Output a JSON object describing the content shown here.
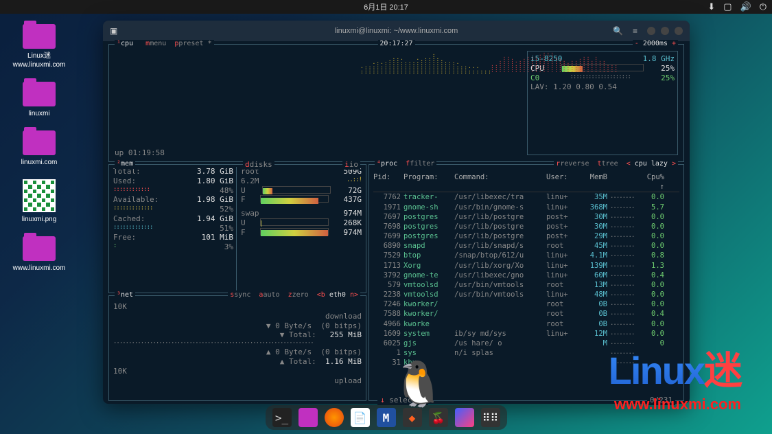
{
  "topbar": {
    "datetime": "6月1日 20:17"
  },
  "desktop": [
    {
      "type": "folder",
      "label": "Linux迷 www.linuxmi.com"
    },
    {
      "type": "folder",
      "label": "linuxmi"
    },
    {
      "type": "folder",
      "label": "linuxmi.com"
    },
    {
      "type": "qr",
      "label": "linuxmi.png"
    },
    {
      "type": "folder",
      "label": "www.linuxmi.com"
    }
  ],
  "terminal": {
    "title": "linuxmi@linuxmi: ~/www.linuxmi.com"
  },
  "btop": {
    "cpu_header": {
      "menu": "menu",
      "preset": "preset *",
      "clock": "20:17:27",
      "rate": "2000ms",
      "minus": "-",
      "plus": "+"
    },
    "uptime": "up 01:19:58",
    "cpu_info": {
      "model": "i5-8250",
      "ghz": "1.8 GHz",
      "cpu_label": "CPU",
      "cpu_pct": "25%",
      "c0_label": "C0",
      "c0_pct": "25%",
      "lav": "LAV: 1.20 0.80 0.54"
    },
    "mem": {
      "title": "mem",
      "total_l": "Total:",
      "total_v": "3.78 GiB",
      "used_l": "Used:",
      "used_v": "1.80 GiB",
      "used_pct": "48%",
      "avail_l": "Available:",
      "avail_v": "1.98 GiB",
      "avail_pct": "52%",
      "cache_l": "Cached:",
      "cache_v": "1.94 GiB",
      "cache_pct": "51%",
      "free_l": "Free:",
      "free_v": "101 MiB",
      "free_pct": "3%"
    },
    "disks": {
      "title": "disks",
      "io": "io",
      "root_l": "root",
      "root_v": "509G",
      "root_io": "6.2M",
      "u": "U",
      "u_v": "72G",
      "f": "F",
      "f_v": "437G",
      "swap_l": "swap",
      "swap_v": "974M",
      "su": "U",
      "su_v": "268K",
      "sf": "F",
      "sf_v": "974M"
    },
    "net": {
      "title": "net",
      "sync": "sync",
      "auto": "auto",
      "zero": "zero",
      "b": "<b",
      "iface": "eth0",
      "n": "n>",
      "ten": "10K",
      "dl": "download",
      "dl_rate": "▼ 0 Byte/s",
      "dl_bits": "(0 bitps)",
      "dl_total_l": "▼ Total:",
      "dl_total": "255 MiB",
      "ul": "upload",
      "ul_rate": "▲ 0 Byte/s",
      "ul_bits": "(0 bitps)",
      "ul_total_l": "▲ Total:",
      "ul_total": "1.16 MiB"
    },
    "proc": {
      "title": "proc",
      "filter": "filter",
      "reverse": "reverse",
      "tree": "tree",
      "sort_l": "<",
      "sort": "cpu lazy",
      "sort_r": ">",
      "header": {
        "pid": "Pid:",
        "prog": "Program:",
        "cmd": "Command:",
        "user": "User:",
        "mem": "MemB",
        "cpu": "Cpu% ↑"
      },
      "rows": [
        {
          "pid": "7762",
          "prog": "tracker-",
          "cmd": "/usr/libexec/tra",
          "user": "linu+",
          "mem": "35M",
          "cpu": "0.0"
        },
        {
          "pid": "1971",
          "prog": "gnome-sh",
          "cmd": "/usr/bin/gnome-s",
          "user": "linu+",
          "mem": "368M",
          "cpu": "5.7"
        },
        {
          "pid": "7697",
          "prog": "postgres",
          "cmd": "/usr/lib/postgre",
          "user": "post+",
          "mem": "30M",
          "cpu": "0.0"
        },
        {
          "pid": "7698",
          "prog": "postgres",
          "cmd": "/usr/lib/postgre",
          "user": "post+",
          "mem": "30M",
          "cpu": "0.0"
        },
        {
          "pid": "7699",
          "prog": "postgres",
          "cmd": "/usr/lib/postgre",
          "user": "post+",
          "mem": "29M",
          "cpu": "0.0"
        },
        {
          "pid": "6890",
          "prog": "snapd",
          "cmd": "/usr/lib/snapd/s",
          "user": "root",
          "mem": "45M",
          "cpu": "0.0"
        },
        {
          "pid": "7529",
          "prog": "btop",
          "cmd": "/snap/btop/612/u",
          "user": "linu+",
          "mem": "4.1M",
          "cpu": "0.8"
        },
        {
          "pid": "1713",
          "prog": "Xorg",
          "cmd": "/usr/lib/xorg/Xo",
          "user": "linu+",
          "mem": "139M",
          "cpu": "1.3"
        },
        {
          "pid": "3792",
          "prog": "gnome-te",
          "cmd": "/usr/libexec/gno",
          "user": "linu+",
          "mem": "60M",
          "cpu": "0.4"
        },
        {
          "pid": "579",
          "prog": "vmtoolsd",
          "cmd": "/usr/bin/vmtools",
          "user": "root",
          "mem": "13M",
          "cpu": "0.0"
        },
        {
          "pid": "2238",
          "prog": "vmtoolsd",
          "cmd": "/usr/bin/vmtools",
          "user": "linu+",
          "mem": "48M",
          "cpu": "0.0"
        },
        {
          "pid": "7246",
          "prog": "kworker/",
          "cmd": "",
          "user": "root",
          "mem": "0B",
          "cpu": "0.0"
        },
        {
          "pid": "7588",
          "prog": "kworker/",
          "cmd": "",
          "user": "root",
          "mem": "0B",
          "cpu": "0.4"
        },
        {
          "pid": "4966",
          "prog": "kworke",
          "cmd": "",
          "user": "root",
          "mem": "0B",
          "cpu": "0.0"
        },
        {
          "pid": "1609",
          "prog": "system",
          "cmd": "  ib/sy    md/sys",
          "user": "linu+",
          "mem": "12M",
          "cpu": "0.0"
        },
        {
          "pid": "6025",
          "prog": "gjs",
          "cmd": "/us   hare/   o",
          "user": "",
          "mem": "M",
          "cpu": "0"
        },
        {
          "pid": "1",
          "prog": "sys",
          "cmd": "  n/i   splas",
          "user": "",
          "mem": "",
          "cpu": ""
        },
        {
          "pid": "31",
          "prog": "khu",
          "cmd": "",
          "user": "",
          "mem": "",
          "cpu": ""
        }
      ],
      "footer": {
        "select": "select",
        "page": "0/231"
      }
    }
  },
  "watermark": {
    "logo": "Linux",
    "mi": "迷",
    "url": "www.linuxmi.com"
  }
}
